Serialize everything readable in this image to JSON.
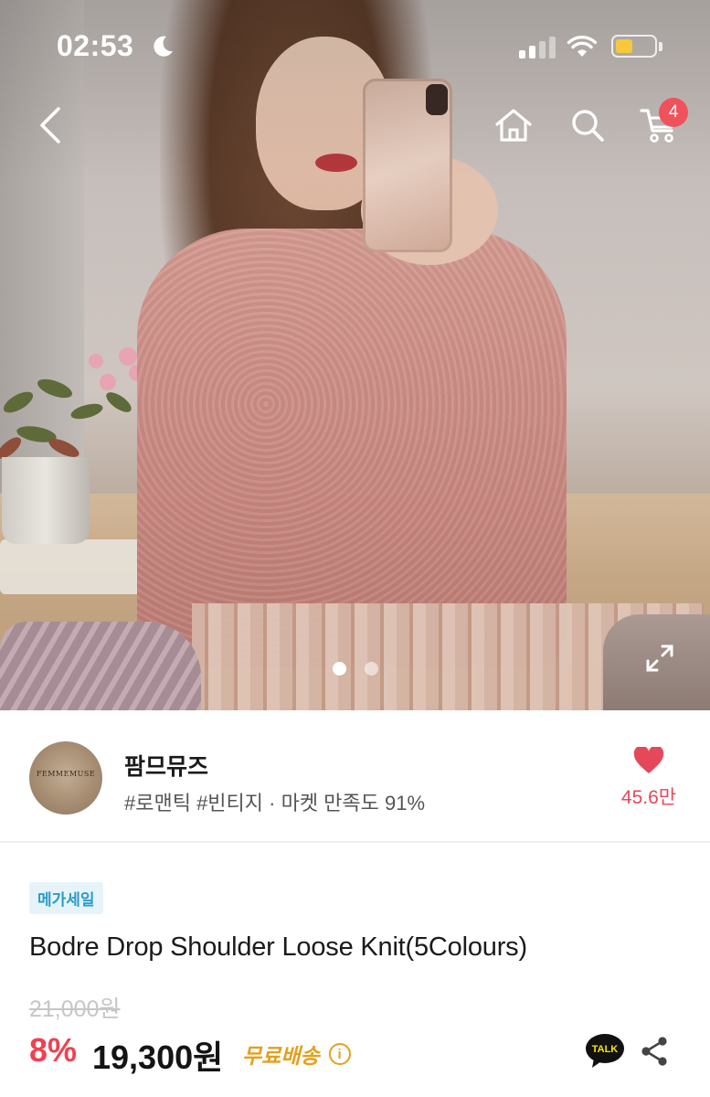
{
  "status_bar": {
    "time": "02:53",
    "battery_level": 0.45,
    "battery_color": "#f5c93b",
    "icons": [
      "moon-icon",
      "cellular-signal-icon",
      "wifi-icon",
      "battery-icon"
    ]
  },
  "nav": {
    "icons": [
      "back-chevron-icon",
      "home-icon",
      "search-icon",
      "cart-icon"
    ],
    "cart_count": "4",
    "badge_color": "#f0525c"
  },
  "gallery": {
    "current_index": 1,
    "total": 2,
    "expand_icon": "expand-icon"
  },
  "seller": {
    "name": "팜므뮤즈",
    "avatar_text": "FEMMEMUSE",
    "tags": "#로맨틱 #빈티지 · 마켓 만족도 91%",
    "like_count": "45.6만",
    "like_icon": "heart-icon",
    "accent_color": "#e5485a"
  },
  "product": {
    "badge": "메가세일",
    "badge_bg": "#e6f4fa",
    "badge_color": "#2a9cc8",
    "title": "Bodre Drop Shoulder Loose Knit(5Colours)",
    "original_price": "21,000원",
    "discount": "8%",
    "discount_color": "#ef4150",
    "price": "19,300원",
    "shipping": "무료배송",
    "shipping_color": "#e3a01c",
    "action_icons": [
      "kakao-talk-icon",
      "share-icon"
    ],
    "talk_label": "TALK"
  }
}
